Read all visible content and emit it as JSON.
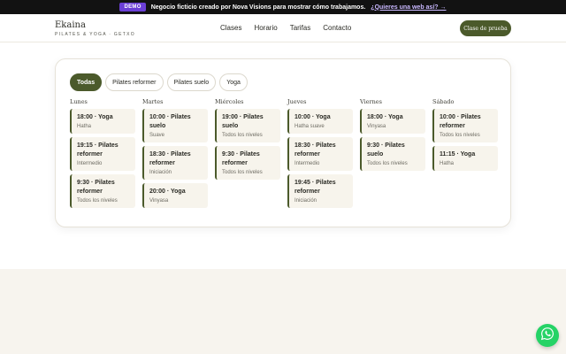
{
  "demo_bar": {
    "badge": "DEMO",
    "text": "Negocio ficticio creado por Nova Visions para mostrar cómo trabajamos.",
    "link": "¿Quieres una web así? →"
  },
  "header": {
    "brand_name": "Ekaina",
    "brand_sub": "PILATES & YOGA · GETXO",
    "nav": [
      "Clases",
      "Horario",
      "Tarifas",
      "Contacto"
    ],
    "cta": "Clase de prueba"
  },
  "filters": [
    {
      "label": "Todas",
      "active": true
    },
    {
      "label": "Pilates reformer",
      "active": false
    },
    {
      "label": "Pilates suelo",
      "active": false
    },
    {
      "label": "Yoga",
      "active": false
    }
  ],
  "schedule": [
    {
      "day": "Lunes",
      "sessions": [
        {
          "title": "18:00 · Yoga",
          "level": "Hatha"
        },
        {
          "title": "19:15 · Pilates reformer",
          "level": "Intermedio"
        },
        {
          "title": "9:30 · Pilates reformer",
          "level": "Todos los niveles"
        }
      ]
    },
    {
      "day": "Martes",
      "sessions": [
        {
          "title": "10:00 · Pilates suelo",
          "level": "Suave"
        },
        {
          "title": "18:30 · Pilates reformer",
          "level": "Iniciación"
        },
        {
          "title": "20:00 · Yoga",
          "level": "Vinyasa"
        }
      ]
    },
    {
      "day": "Miércoles",
      "sessions": [
        {
          "title": "19:00 · Pilates suelo",
          "level": "Todos los niveles"
        },
        {
          "title": "9:30 · Pilates reformer",
          "level": "Todos los niveles"
        }
      ]
    },
    {
      "day": "Jueves",
      "sessions": [
        {
          "title": "10:00 · Yoga",
          "level": "Hatha suave"
        },
        {
          "title": "18:30 · Pilates reformer",
          "level": "Intermedio"
        },
        {
          "title": "19:45 · Pilates reformer",
          "level": "Iniciación"
        }
      ]
    },
    {
      "day": "Viernes",
      "sessions": [
        {
          "title": "18:00 · Yoga",
          "level": "Vinyasa"
        },
        {
          "title": "9:30 · Pilates suelo",
          "level": "Todos los niveles"
        }
      ]
    },
    {
      "day": "Sábado",
      "sessions": [
        {
          "title": "10:00 · Pilates reformer",
          "level": "Todos los niveles"
        },
        {
          "title": "11:15 · Yoga",
          "level": "Hatha"
        }
      ]
    }
  ],
  "icons": {
    "whatsapp": "whatsapp-icon"
  },
  "colors": {
    "accent": "#4b5a2b",
    "demo_badge": "#6b3fd6",
    "whatsapp": "#25d366"
  }
}
